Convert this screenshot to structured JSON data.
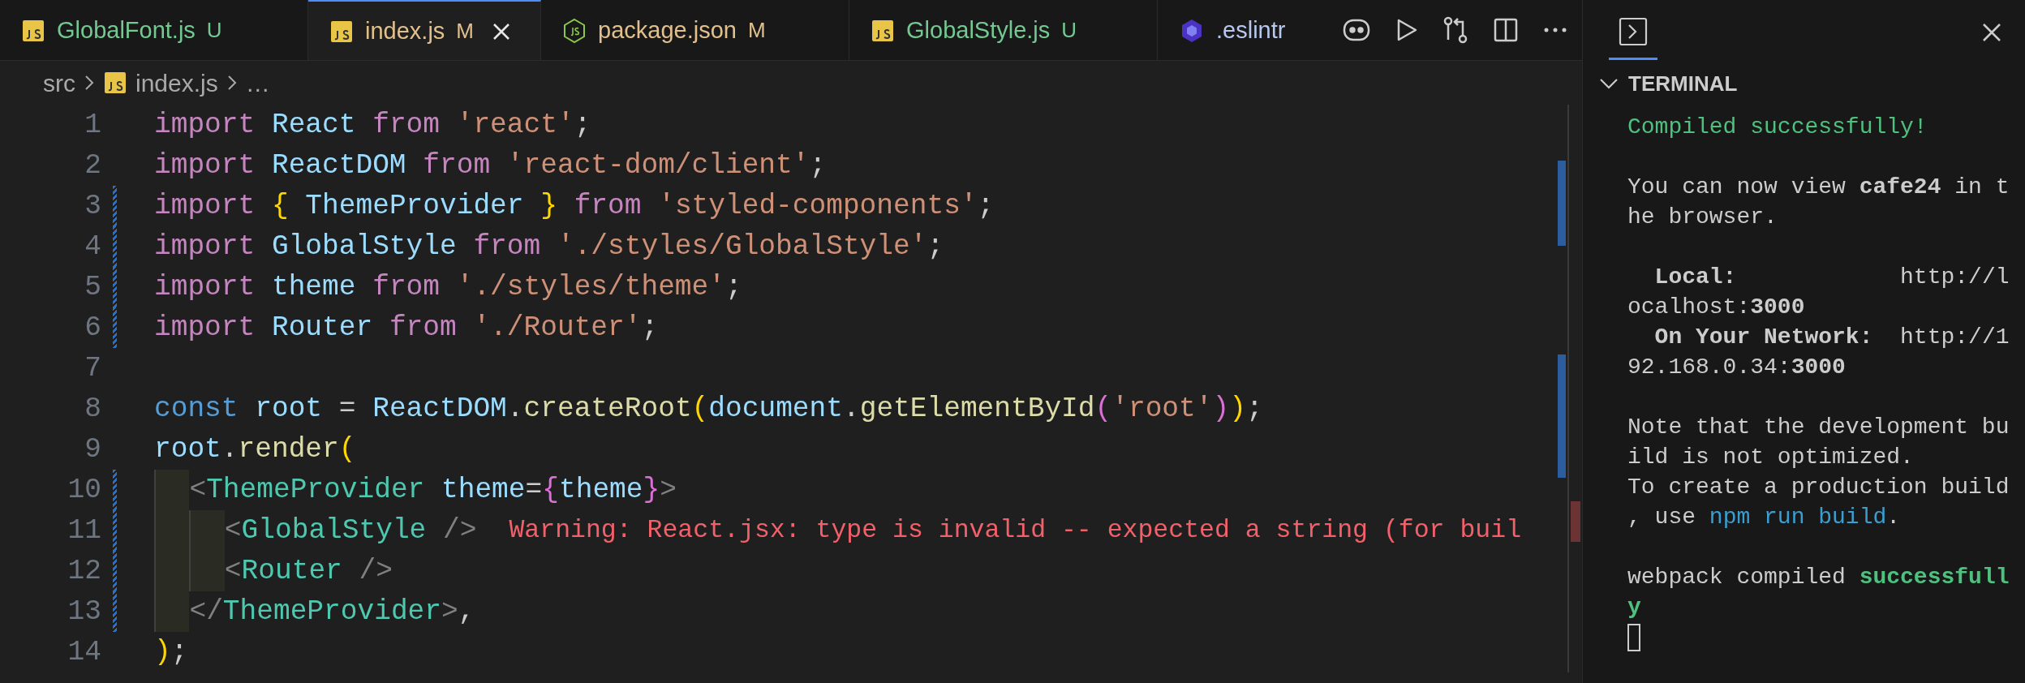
{
  "tabs": [
    {
      "label": "GlobalFont.js",
      "kind": "js",
      "status": "U",
      "color": "#73c991",
      "selected": false
    },
    {
      "label": "index.js",
      "kind": "js",
      "status": "M",
      "color": "#e2c08d",
      "selected": true
    },
    {
      "label": "package.json",
      "kind": "json",
      "status": "M",
      "color": "#e2c08d",
      "selected": false
    },
    {
      "label": "GlobalStyle.js",
      "kind": "js",
      "status": "U",
      "color": "#73c991",
      "selected": false
    },
    {
      "label": ".eslintr",
      "kind": "eslint",
      "color": "#b8c7ee",
      "selected": false
    }
  ],
  "breadcrumb": [
    {
      "label": "src",
      "kind": "folder"
    },
    {
      "label": "index.js",
      "kind": "js"
    },
    {
      "label": "…",
      "kind": "more"
    }
  ],
  "code_lines": [
    {
      "number": "1",
      "modified": false,
      "tokens": [
        {
          "t": "import",
          "color": "#c586c0"
        },
        {
          "t": " React ",
          "color": "#9cdcfe"
        },
        {
          "t": "from",
          "color": "#c586c0"
        },
        {
          "t": " 'react'",
          "color": "#ce9178"
        },
        {
          "t": ";",
          "color": "#cccccc"
        }
      ]
    },
    {
      "number": "2",
      "modified": false,
      "tokens": [
        {
          "t": "import",
          "color": "#c586c0"
        },
        {
          "t": " ReactDOM ",
          "color": "#9cdcfe"
        },
        {
          "t": "from",
          "color": "#c586c0"
        },
        {
          "t": " 'react-dom/client'",
          "color": "#ce9178"
        },
        {
          "t": ";",
          "color": "#cccccc"
        }
      ]
    },
    {
      "number": "3",
      "modified": true,
      "tokens": [
        {
          "t": "import ",
          "color": "#c586c0"
        },
        {
          "t": "{",
          "color": "#ffd700"
        },
        {
          "t": " ThemeProvider ",
          "color": "#9cdcfe"
        },
        {
          "t": "}",
          "color": "#ffd700"
        },
        {
          "t": " from",
          "color": "#c586c0"
        },
        {
          "t": " 'styled-components'",
          "color": "#ce9178"
        },
        {
          "t": ";",
          "color": "#cccccc"
        }
      ]
    },
    {
      "number": "4",
      "modified": true,
      "tokens": [
        {
          "t": "import",
          "color": "#c586c0"
        },
        {
          "t": " GlobalStyle ",
          "color": "#9cdcfe"
        },
        {
          "t": "from",
          "color": "#c586c0"
        },
        {
          "t": " './styles/GlobalStyle'",
          "color": "#ce9178"
        },
        {
          "t": ";",
          "color": "#cccccc"
        }
      ]
    },
    {
      "number": "5",
      "modified": true,
      "tokens": [
        {
          "t": "import",
          "color": "#c586c0"
        },
        {
          "t": " theme ",
          "color": "#9cdcfe"
        },
        {
          "t": "from",
          "color": "#c586c0"
        },
        {
          "t": " './styles/theme'",
          "color": "#ce9178"
        },
        {
          "t": ";",
          "color": "#cccccc"
        }
      ]
    },
    {
      "number": "6",
      "modified": true,
      "tokens": [
        {
          "t": "import",
          "color": "#c586c0"
        },
        {
          "t": " Router ",
          "color": "#9cdcfe"
        },
        {
          "t": "from",
          "color": "#c586c0"
        },
        {
          "t": " './Router'",
          "color": "#ce9178"
        },
        {
          "t": ";",
          "color": "#cccccc"
        }
      ]
    },
    {
      "number": "7",
      "modified": false
    },
    {
      "number": "8",
      "modified": false,
      "tokens": [
        {
          "t": "const",
          "color": "#569cd6"
        },
        {
          "t": " root ",
          "color": "#9cdcfe"
        },
        {
          "t": "= ",
          "color": "#cccccc"
        },
        {
          "t": "ReactDOM",
          "color": "#9cdcfe"
        },
        {
          "t": ".",
          "color": "#cccccc"
        },
        {
          "t": "createRoot",
          "color": "#dcdcaa"
        },
        {
          "t": "(",
          "color": "#ffd700"
        },
        {
          "t": "document",
          "color": "#9cdcfe"
        },
        {
          "t": ".",
          "color": "#cccccc"
        },
        {
          "t": "getElementById",
          "color": "#dcdcaa"
        },
        {
          "t": "(",
          "color": "#da70d6"
        },
        {
          "t": "'root'",
          "color": "#ce9178"
        },
        {
          "t": ")",
          "color": "#da70d6"
        },
        {
          "t": ")",
          "color": "#ffd700"
        },
        {
          "t": ";",
          "color": "#cccccc"
        }
      ]
    },
    {
      "number": "9",
      "modified": false,
      "tokens": [
        {
          "t": "root",
          "color": "#9cdcfe"
        },
        {
          "t": ".",
          "color": "#cccccc"
        },
        {
          "t": "render",
          "color": "#dcdcaa"
        },
        {
          "t": "(",
          "color": "#ffd700"
        }
      ]
    },
    {
      "number": "10",
      "modified": true,
      "tokens": [
        {
          "t": "  <",
          "color": "#808080"
        },
        {
          "t": "ThemeProvider",
          "color": "#4ec9b0"
        },
        {
          "t": " theme",
          "color": "#9cdcfe"
        },
        {
          "t": "=",
          "color": "#cccccc"
        },
        {
          "t": "{",
          "color": "#da70d6"
        },
        {
          "t": "theme",
          "color": "#9cdcfe"
        },
        {
          "t": "}",
          "color": "#da70d6"
        },
        {
          "t": ">",
          "color": "#808080"
        }
      ]
    },
    {
      "number": "11",
      "modified": true,
      "tokens": [
        {
          "t": "    <",
          "color": "#808080"
        },
        {
          "t": "GlobalStyle",
          "color": "#4ec9b0"
        },
        {
          "t": " />",
          "color": "#808080"
        }
      ],
      "hint": "Warning: React.jsx: type is invalid -- expected a string (for buil"
    },
    {
      "number": "12",
      "modified": true,
      "tokens": [
        {
          "t": "    <",
          "color": "#808080"
        },
        {
          "t": "Router",
          "color": "#4ec9b0"
        },
        {
          "t": " />",
          "color": "#808080"
        }
      ]
    },
    {
      "number": "13",
      "modified": true,
      "tokens": [
        {
          "t": "  </",
          "color": "#808080"
        },
        {
          "t": "ThemeProvider",
          "color": "#4ec9b0"
        },
        {
          "t": ">",
          "color": "#808080"
        },
        {
          "t": ",",
          "color": "#cccccc"
        }
      ]
    },
    {
      "number": "14",
      "modified": false,
      "tokens": [
        {
          "t": ")",
          "color": "#ffd700"
        },
        {
          "t": ";",
          "color": "#cccccc"
        }
      ]
    }
  ],
  "panel": {
    "section": "TERMINAL",
    "expanded": true,
    "lines": [
      {
        "kind": "text",
        "segments": [
          {
            "t": "Compiled successfully!",
            "color": "#4fc17f"
          }
        ]
      },
      {
        "kind": "blank"
      },
      {
        "kind": "text",
        "segments": [
          {
            "t": "You can now view **cafe24** in t"
          }
        ]
      },
      {
        "kind": "text",
        "segments": [
          {
            "t": "he browser."
          }
        ]
      },
      {
        "kind": "blank"
      },
      {
        "kind": "text",
        "segments": [
          {
            "t": "  **Local:**            http://l"
          }
        ]
      },
      {
        "kind": "text",
        "segments": [
          {
            "t": "ocalhost:**3000**"
          }
        ]
      },
      {
        "kind": "text",
        "segments": [
          {
            "t": "  **On Your Network:**  http://1"
          }
        ]
      },
      {
        "kind": "text",
        "segments": [
          {
            "t": "92.168.0.34:**3000**"
          }
        ]
      },
      {
        "kind": "blank"
      },
      {
        "kind": "text",
        "segments": [
          {
            "t": "Note that the development bu"
          }
        ]
      },
      {
        "kind": "text",
        "segments": [
          {
            "t": "ild is not optimized."
          }
        ]
      },
      {
        "kind": "text",
        "segments": [
          {
            "t": "To create a production build"
          }
        ]
      },
      {
        "kind": "text",
        "segments": [
          {
            "t": ", use "
          },
          {
            "t": "npm run build",
            "color": "#3a9fd0"
          },
          {
            "t": "."
          }
        ]
      },
      {
        "kind": "blank"
      },
      {
        "kind": "text",
        "segments": [
          {
            "t": "webpack compiled "
          },
          {
            "t": "**successfull**",
            "color": "#4fc17f"
          }
        ]
      },
      {
        "kind": "text",
        "segments": [
          {
            "t": "**y**",
            "color": "#4fc17f"
          }
        ]
      },
      {
        "kind": "cursor"
      }
    ]
  }
}
